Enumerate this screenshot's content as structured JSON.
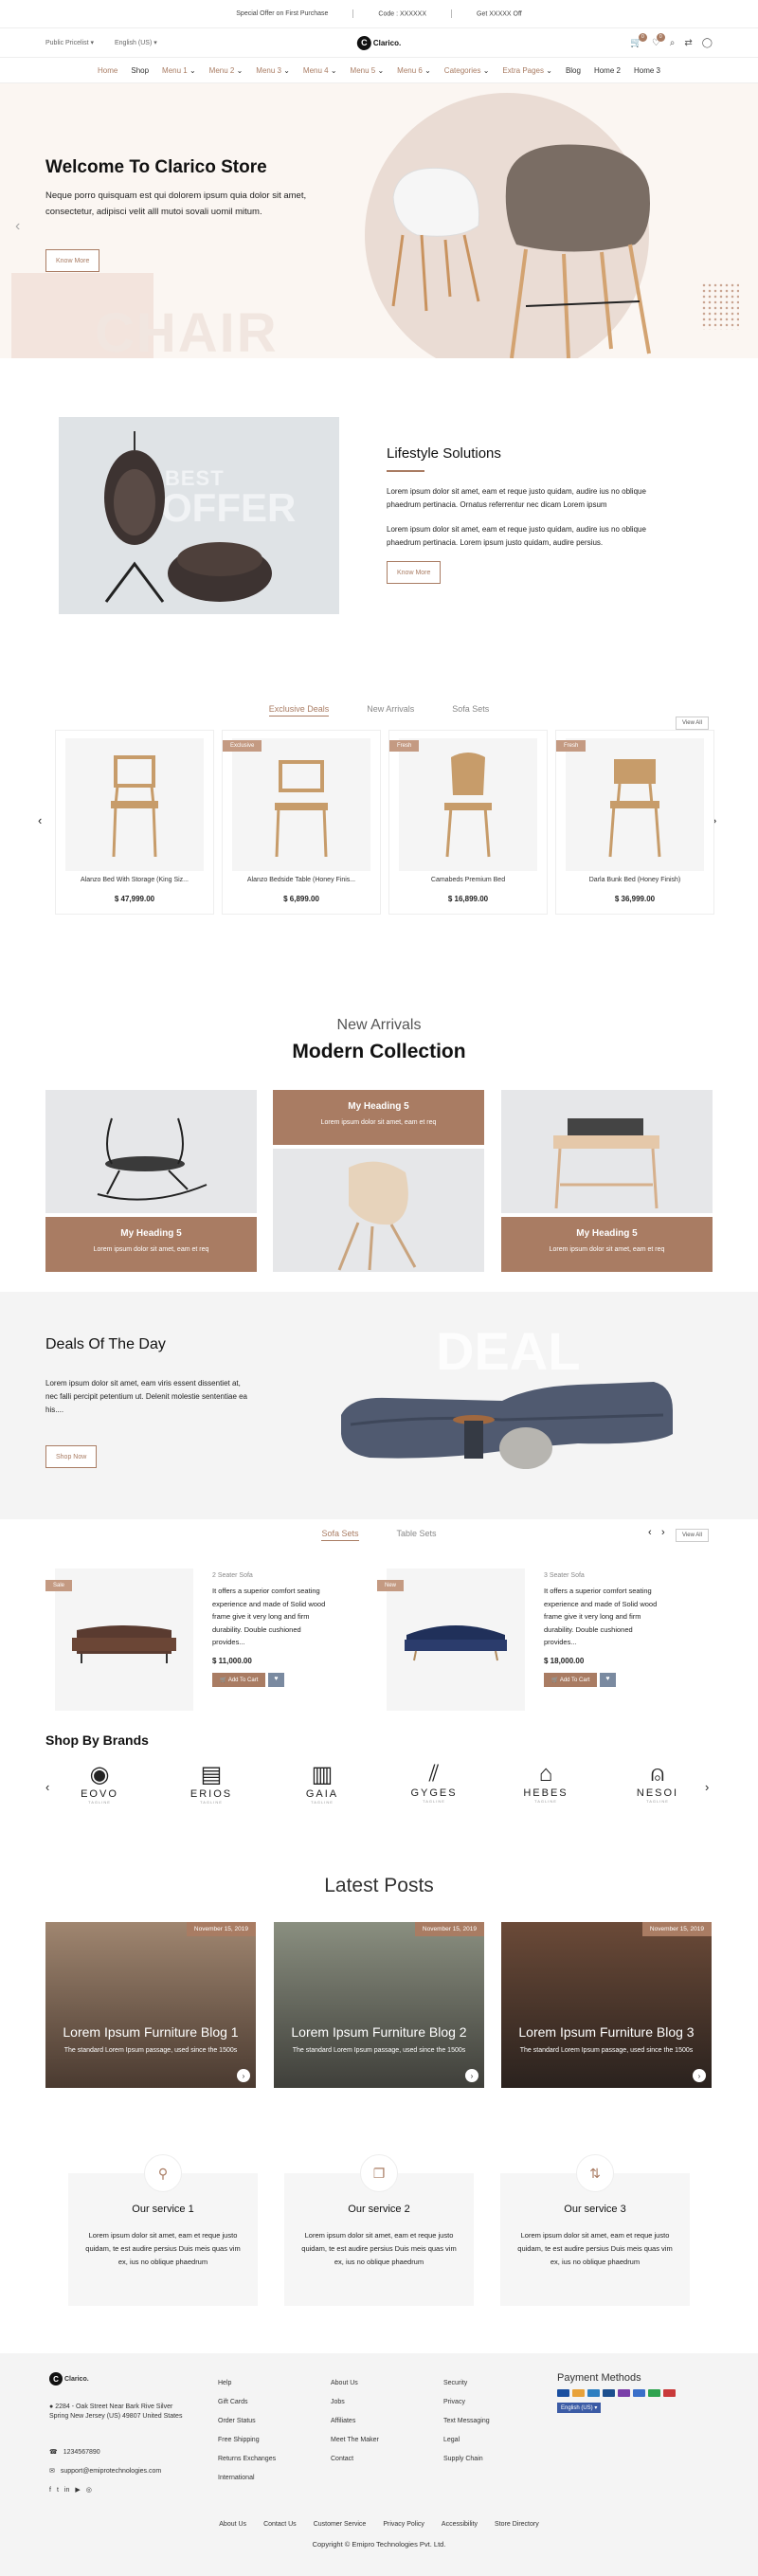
{
  "topbar": {
    "offer": "Special Offer on First Purchase",
    "code": "Code : XXXXXX",
    "get": "Get XXXXX Off"
  },
  "header": {
    "pricelist": "Public Pricelist",
    "language": "English (US)",
    "logo_text": "Clarico.",
    "cart_count": "0",
    "wish_count": "0"
  },
  "nav": [
    "Home",
    "Shop",
    "Menu 1",
    "Menu 2",
    "Menu 3",
    "Menu 4",
    "Menu 5",
    "Menu 6",
    "Categories",
    "Extra Pages",
    "Blog",
    "Home 2",
    "Home 3"
  ],
  "hero": {
    "title": "Welcome To Clarico Store",
    "text": "Neque porro quisquam est qui dolorem ipsum quia dolor sit amet, consectetur, adipisci velit alll mutoi sovali uomil mitum.",
    "button": "Know More",
    "watermark": "CHAIR"
  },
  "lifestyle": {
    "offer_small": "BEST",
    "offer_big": "OFFER",
    "title": "Lifestyle Solutions",
    "p1": "Lorem ipsum dolor sit amet, eam et reque justo quidam, audire ius no oblique phaedrum pertinacia. Ornatus referrentur nec dicam Lorem ipsum",
    "p2": "Lorem ipsum dolor sit amet, eam et reque justo quidam, audire ius no oblique phaedrum pertinacia. Lorem ipsum justo quidam, audire persius.",
    "button": "Know More"
  },
  "deals": {
    "tabs": [
      "Exclusive Deals",
      "New Arrivals",
      "Sofa Sets"
    ],
    "view_all": "View All",
    "products": [
      {
        "name": "Alanzo Bed With Storage (King Siz...",
        "price": "$ 47,999.00",
        "tag": ""
      },
      {
        "name": "Alanzo Bedside Table (Honey Finis...",
        "price": "$ 6,899.00",
        "tag": "Exclusive"
      },
      {
        "name": "Camabeds Premium Bed",
        "price": "$ 16,899.00",
        "tag": "Fresh"
      },
      {
        "name": "Darla Bunk Bed (Honey Finish)",
        "price": "$ 36,999.00",
        "tag": "Fresh"
      }
    ]
  },
  "collection": {
    "sub": "New Arrivals",
    "title": "Modern Collection",
    "tiles": [
      {
        "heading": "My Heading 5",
        "text": "Lorem ipsum dolor sit amet, eam et req"
      },
      {
        "heading": "My Heading 5",
        "text": "Lorem ipsum dolor sit amet, eam et req"
      },
      {
        "heading": "My Heading 5",
        "text": "Lorem ipsum dolor sit amet, eam et req"
      }
    ]
  },
  "dealday": {
    "title": "Deals Of The Day",
    "text": "Lorem ipsum dolor sit amet, eam viris essent dissentiet at, nec falli percipit petentium ut. Delenit molestie sententiae ea his....",
    "button": "Shop Now",
    "watermark": "DEAL"
  },
  "sofas": {
    "tabs": [
      "Sofa Sets",
      "Table Sets"
    ],
    "view_all": "View All",
    "items": [
      {
        "tag": "Sale",
        "category": "2 Seater Sofa",
        "desc": "It offers a superior comfort seating experience and made of Solid wood frame give it very long and firm durability. Double cushioned provides...",
        "price": "$ 11,000.00",
        "add": "Add To Cart"
      },
      {
        "tag": "New",
        "category": "3 Seater Sofa",
        "desc": "It offers a superior comfort seating experience and made of Solid wood frame give it very long and firm durability. Double cushioned provides...",
        "price": "$ 18,000.00",
        "add": "Add To Cart"
      }
    ]
  },
  "brands": {
    "title": "Shop By Brands",
    "items": [
      {
        "name": "EOVO",
        "tagline": "TAGLINE"
      },
      {
        "name": "ERIOS",
        "tagline": "TAGLINE"
      },
      {
        "name": "GAIA",
        "tagline": "TAGLINE"
      },
      {
        "name": "GYGES",
        "tagline": "TAGLINE"
      },
      {
        "name": "HEBES",
        "tagline": "TAGLINE"
      },
      {
        "name": "NESOI",
        "tagline": "TAGLINE"
      }
    ]
  },
  "posts": {
    "title": "Latest Posts",
    "items": [
      {
        "date": "November 15, 2019",
        "title": "Lorem Ipsum Furniture Blog 1",
        "text": "The standard Lorem Ipsum passage, used since the 1500s"
      },
      {
        "date": "November 15, 2019",
        "title": "Lorem Ipsum Furniture Blog 2",
        "text": "The standard Lorem Ipsum passage, used since the 1500s"
      },
      {
        "date": "November 15, 2019",
        "title": "Lorem Ipsum Furniture Blog 3",
        "text": "The standard Lorem Ipsum passage, used since the 1500s"
      }
    ]
  },
  "services": [
    {
      "title": "Our service 1",
      "text": "Lorem ipsum dolor sit amet, eam et reque justo quidam, te est audire persius Duis meis quas vim ex, ius no oblique phaedrum"
    },
    {
      "title": "Our service 2",
      "text": "Lorem ipsum dolor sit amet, eam et reque justo quidam, te est audire persius Duis meis quas vim ex, ius no oblique phaedrum"
    },
    {
      "title": "Our service 3",
      "text": "Lorem ipsum dolor sit amet, eam et reque justo quidam, te est audire persius Duis meis quas vim ex, ius no oblique phaedrum"
    }
  ],
  "footer": {
    "logo": "Clarico.",
    "address": "2284 - Oak Street Near Bark Rive Silver Spring New Jersey (US) 49807 United States",
    "phone": "1234567890",
    "email": "support@emiprotechnologies.com",
    "col1": [
      "Help",
      "Gift Cards",
      "Order Status",
      "Free Shipping",
      "Returns Exchanges",
      "International"
    ],
    "col2": [
      "About Us",
      "Jobs",
      "Affiliates",
      "Meet The Maker",
      "Contact"
    ],
    "col3": [
      "Security",
      "Privacy",
      "Text Messaging",
      "Legal",
      "Supply Chain"
    ],
    "payment_title": "Payment Methods",
    "lang": "English (US)",
    "bottom": [
      "About Us",
      "Contact Us",
      "Customer Service",
      "Privacy Policy",
      "Accessibility",
      "Store Directory"
    ],
    "copyright": "Copyright © Emipro Technologies Pvt. Ltd."
  },
  "colors": {
    "accent": "#a97c63",
    "hero_bg": "#fbf6f2",
    "gray_bg": "#f4f4f4"
  }
}
